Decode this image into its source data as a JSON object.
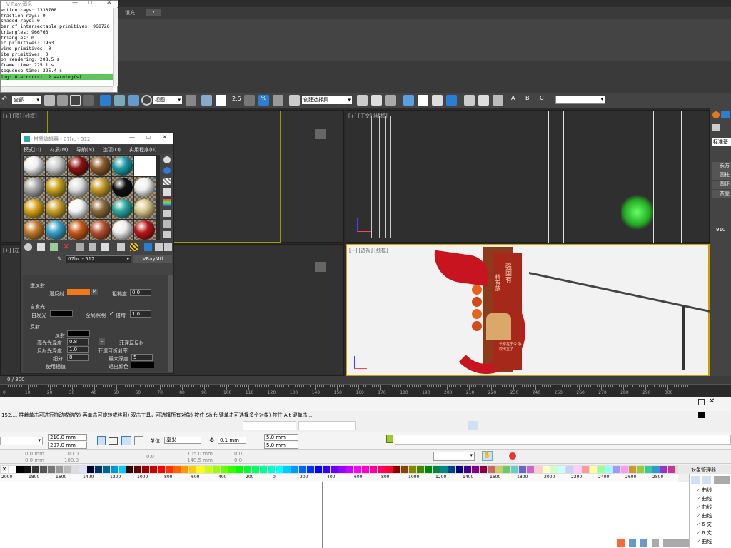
{
  "max": {
    "top_field": "填充",
    "toolbar": {
      "select_filter": "全部",
      "view_dropdown": "视图",
      "selection_set": "创建选择集",
      "snap_25": "2.5",
      "percent": "%",
      "sub_a": "A",
      "sub_b": "B",
      "sub_c": "C"
    },
    "viewports": {
      "top_left_label": "[+] [顶] [线框]",
      "top_right_label": "[+] [正交] [线框]",
      "bottom_left_label": "[+] [左] [线框]",
      "bottom_right_label": "[+] [透视] [线框]"
    },
    "timeline": {
      "frame_counter": "0 / 300",
      "ticks": [
        "0",
        "10",
        "20",
        "30",
        "40",
        "50",
        "60",
        "70",
        "80",
        "90",
        "100",
        "110",
        "120",
        "130",
        "140",
        "150",
        "160",
        "170",
        "180",
        "190",
        "200",
        "210",
        "220",
        "230",
        "240",
        "250",
        "260",
        "270",
        "280",
        "290",
        "300"
      ]
    },
    "status_bar": "152.... 推着单击可进行拖动或缩放) 再单击可旋转或移到) 双击工具，可选择所有对象) 按住 Shift 键单击可选择多个对象) 按住 Alt 键单击...",
    "right_panel": {
      "label_std": "标准基",
      "items": [
        "长方",
        "圆柱",
        "圆环",
        "茶壶"
      ],
      "value": "910"
    }
  },
  "vray_log": {
    "title": "V-Ray 消息",
    "lines": [
      "ection rays: 1330708",
      "fraction rays: 0",
      "shaded rays: 0",
      "ber of intersectable primitives: 968726",
      "triangles: 966763",
      "triangles: 0",
      "ic primitives: 1963",
      "ving primitives: 0",
      "ite primitives: 0",
      "on rendering: 208.5 s",
      "frame time: 225.1 s",
      "sequence time: 225.4 s"
    ],
    "status_line": "ing: 0 error(s), 2 warning(s)"
  },
  "material_editor": {
    "title": "材质编辑器 - 07hc - 512",
    "menu": [
      "模式(D)",
      "材质(M)",
      "导航(N)",
      "选项(O)",
      "实用程序(U)"
    ],
    "material_name": "07hc - 512",
    "material_type": "VRayMtl",
    "diffuse_group": "漫反射",
    "diffuse_label": "漫反射",
    "roughness_label": "粗糙度",
    "roughness_value": "0.0",
    "self_illum_group": "自发光",
    "self_illum_label": "自发光",
    "gi_label": "全局照明",
    "multiplier_label": "倍增",
    "multiplier_value": "1.0",
    "reflect_group": "反射",
    "reflect_label": "反射",
    "hl_gloss_label": "高光光泽度",
    "hl_gloss_value": "0.8",
    "lock_label": "L",
    "fresnel_label": "菲涅耳反射",
    "refl_gloss_label": "反射光泽度",
    "refl_gloss_value": "1.0",
    "fresnel_ior_label": "菲涅耳折射率",
    "subdivs_label": "细分",
    "subdivs_value": "8",
    "max_depth_label": "最大深度",
    "max_depth_value": "5",
    "interp_label": "使用插值",
    "exit_color_label": "退出颜色",
    "m_button": "M",
    "colors": {
      "diffuse": "#f07818",
      "self_illum": "#000000",
      "reflect": "#000000"
    }
  },
  "corel": {
    "page_width": "210.0 mm",
    "page_height": "297.0 mm",
    "units_label": "单位:",
    "units_value": "毫米",
    "nudge": "0.1 mm",
    "dup_x": "5.0 mm",
    "dup_y": "5.0 mm",
    "pos_x": "0.0 mm",
    "pos_y": "0.0 mm",
    "scale_x": "100.0",
    "scale_y": "100.0",
    "angle": "0.0",
    "size_w": "105.0 mm",
    "size_h": "148.5 mm",
    "skew_x": "0.0",
    "skew_y": "0.0",
    "object_manager": "对象管理器",
    "ruler": [
      "2000",
      "1800",
      "1600",
      "1400",
      "1200",
      "1000",
      "800",
      "600",
      "400",
      "200",
      "0",
      "200",
      "400",
      "600",
      "800",
      "1000",
      "1200",
      "1400",
      "1600",
      "1800",
      "2000",
      "2200",
      "2400",
      "2600",
      "2800"
    ],
    "obj_items": [
      "曲线",
      "曲线",
      "曲线",
      "曲线",
      "6 文",
      "6 文",
      "曲线"
    ]
  },
  "render": {
    "sign_text1": "强国有",
    "sign_text2": "精有放",
    "sign_text3": "长幸在于令 争取出五了"
  }
}
